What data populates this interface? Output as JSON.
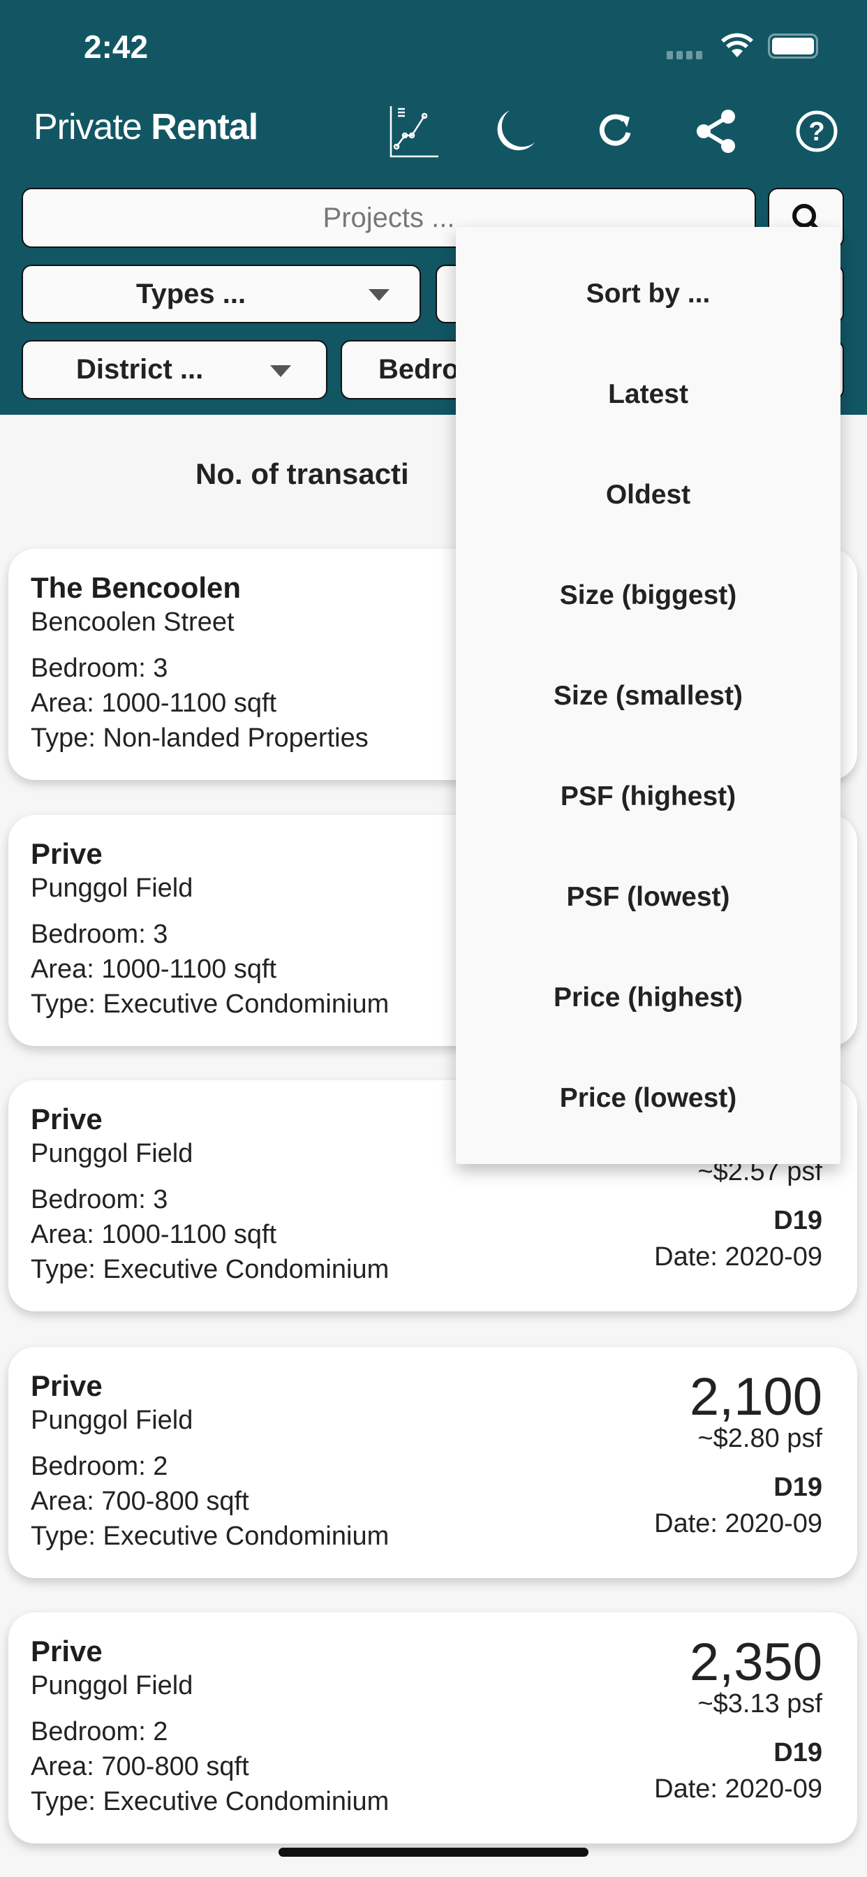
{
  "status": {
    "time": "2:42"
  },
  "app": {
    "title_light": "Private",
    "title_bold": "Rental"
  },
  "toolbar": {
    "icons": [
      "chart-icon",
      "moon-icon",
      "refresh-icon",
      "share-icon",
      "help-icon"
    ]
  },
  "search": {
    "placeholder": "Projects ..."
  },
  "filters": {
    "types": "Types ...",
    "district": "District ...",
    "bedroom": "Bedro"
  },
  "summary": {
    "label": "No. of transacti"
  },
  "sort_menu": {
    "items": [
      "Sort by ...",
      "Latest",
      "Oldest",
      "Size (biggest)",
      "Size (smallest)",
      "PSF (highest)",
      "PSF (lowest)",
      "Price (highest)",
      "Price (lowest)"
    ]
  },
  "cards": [
    {
      "name": "The Bencoolen",
      "street": "Bencoolen Street",
      "bedroom": "Bedroom: 3",
      "area": "Area: 1000-1100 sqft",
      "type": "Type: Non-landed Properties"
    },
    {
      "name": "Prive",
      "street": "Punggol Field",
      "bedroom": "Bedroom: 3",
      "area": "Area: 1000-1100 sqft",
      "type": "Type: Executive Condominium"
    },
    {
      "name": "Prive",
      "street": "Punggol Field",
      "bedroom": "Bedroom: 3",
      "area": "Area: 1000-1100 sqft",
      "type": "Type: Executive Condominium",
      "psf": "~$2.57 psf",
      "district": "D19",
      "date": "Date: 2020-09"
    },
    {
      "name": "Prive",
      "street": "Punggol Field",
      "bedroom": "Bedroom: 2",
      "area": "Area: 700-800 sqft",
      "type": "Type: Executive Condominium",
      "price": "2,100",
      "psf": "~$2.80 psf",
      "district": "D19",
      "date": "Date: 2020-09"
    },
    {
      "name": "Prive",
      "street": "Punggol Field",
      "bedroom": "Bedroom: 2",
      "area": "Area: 700-800 sqft",
      "type": "Type: Executive Condominium",
      "price": "2,350",
      "psf": "~$3.13 psf",
      "district": "D19",
      "date": "Date: 2020-09"
    }
  ],
  "colors": {
    "header": "#125664",
    "background": "#f6f6f6"
  }
}
